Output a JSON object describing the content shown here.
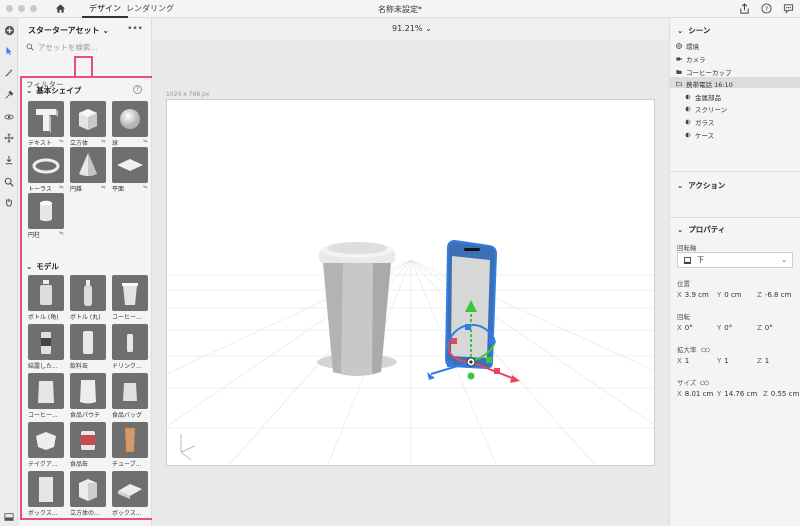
{
  "titlebar": {
    "tabs": [
      {
        "label": "デザイン"
      },
      {
        "label": "レンダリング"
      }
    ],
    "document_title": "名称未設定*"
  },
  "assets": {
    "title": "スターターアセット",
    "search_placeholder": "アセットを検索...",
    "filter_label": "フィルター",
    "basic_shapes": {
      "heading": "基本シェイプ",
      "items": [
        {
          "label": "テキスト"
        },
        {
          "label": "立方体"
        },
        {
          "label": "球"
        },
        {
          "label": "トーラス"
        },
        {
          "label": "円錐"
        },
        {
          "label": "平面"
        },
        {
          "label": "円柱"
        }
      ]
    },
    "models": {
      "heading": "モデル",
      "items": [
        {
          "label": "ボトル (角)"
        },
        {
          "label": "ボトル (丸)"
        },
        {
          "label": "コーヒー..."
        },
        {
          "label": "結露した..."
        },
        {
          "label": "飲料缶"
        },
        {
          "label": "ドリンク..."
        },
        {
          "label": "コーヒー..."
        },
        {
          "label": "食品パウチ"
        },
        {
          "label": "食品バッグ"
        },
        {
          "label": "テイクア..."
        },
        {
          "label": "食品缶"
        },
        {
          "label": "チューブ..."
        },
        {
          "label": "ボックス..."
        },
        {
          "label": "立方体の..."
        },
        {
          "label": "ボックス..."
        }
      ]
    }
  },
  "canvas": {
    "zoom": "91.21%",
    "size_label": "1024 x 768 px"
  },
  "scene": {
    "heading": "シーン",
    "items": [
      {
        "label": "環境"
      },
      {
        "label": "カメラ"
      },
      {
        "label": "コーヒーカップ"
      },
      {
        "label": "携帯電話 16:10"
      }
    ],
    "subitems": [
      {
        "label": "金属部品"
      },
      {
        "label": "スクリーン"
      },
      {
        "label": "ガラス"
      },
      {
        "label": "ケース"
      }
    ]
  },
  "actions": {
    "heading": "アクション"
  },
  "properties": {
    "heading": "プロパティ",
    "pivot_label": "回転軸",
    "pivot_value": "下",
    "position": {
      "label": "位置",
      "x": "3.9 cm",
      "y": "0 cm",
      "z": "-6.8 cm"
    },
    "rotation": {
      "label": "回転",
      "x": "0°",
      "y": "0°",
      "z": "0°"
    },
    "scale": {
      "label": "拡大率",
      "x": "1",
      "y": "1",
      "z": "1"
    },
    "size": {
      "label": "サイズ",
      "x": "8.01 cm",
      "y": "14.76 cm",
      "z": "0.55 cm"
    },
    "axis_keys": {
      "x": "X",
      "y": "Y",
      "z": "Z"
    }
  },
  "colors": {
    "highlight": "#e8507a",
    "gizmo_blue": "#2f7fe6",
    "gizmo_green": "#3cc73c",
    "gizmo_red": "#e84560"
  }
}
